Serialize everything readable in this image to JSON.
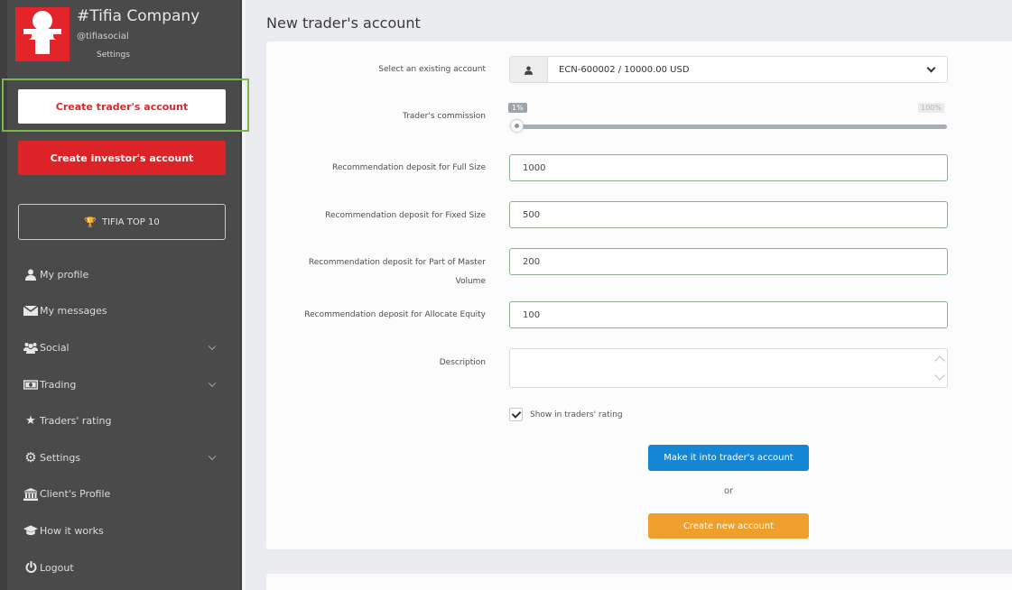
{
  "sidebar": {
    "brand": {
      "name": "#Tifia Company",
      "handle": "@tifiasocial",
      "settings_link": "Settings"
    },
    "buttons": {
      "create_trader": "Create trader's account",
      "create_investor": "Create investor's account",
      "top10": "TIFIA TOP 10"
    },
    "items": [
      {
        "label": "My profile",
        "icon": "user-icon",
        "has_submenu": false
      },
      {
        "label": "My messages",
        "icon": "envelope-icon",
        "has_submenu": false
      },
      {
        "label": "Social",
        "icon": "users-icon",
        "has_submenu": true
      },
      {
        "label": "Trading",
        "icon": "money-icon",
        "has_submenu": true
      },
      {
        "label": "Traders' rating",
        "icon": "star-icon",
        "has_submenu": false
      },
      {
        "label": "Settings",
        "icon": "gear-icon",
        "has_submenu": true
      },
      {
        "label": "Client's Profile",
        "icon": "bank-icon",
        "has_submenu": false
      },
      {
        "label": "How it works",
        "icon": "graduation-cap-icon",
        "has_submenu": false
      },
      {
        "label": "Logout",
        "icon": "power-icon",
        "has_submenu": false
      }
    ]
  },
  "main": {
    "title": "New trader's account",
    "form": {
      "account_label": "Select an existing account",
      "account_value": "ECN-600002 / 10000.00 USD",
      "commission_label": "Trader's commission",
      "commission": {
        "min_label": "1%",
        "max_label": "100%",
        "value_percent": 1
      },
      "full_size_label": "Recommendation deposit for Full Size",
      "full_size_value": "1000",
      "fixed_size_label": "Recommendation deposit for Fixed Size",
      "fixed_size_value": "500",
      "part_master_label": "Recommendation deposit for Part of Master Volume",
      "part_master_value": "200",
      "allocate_equity_label": "Recommendation deposit for Allocate Equity",
      "allocate_equity_value": "100",
      "description_label": "Description",
      "description_value": "",
      "show_rating_label": "Show in traders' rating",
      "show_rating_checked": true,
      "make_button": "Make it into trader's account",
      "or_text": "or",
      "create_button": "Create new account"
    }
  },
  "colors": {
    "sidebar_bg": "#4a4a4a",
    "brand_red": "#dc2327",
    "highlight_green": "#7ab648",
    "primary_blue": "#1486d3",
    "accent_orange": "#efa02c"
  }
}
